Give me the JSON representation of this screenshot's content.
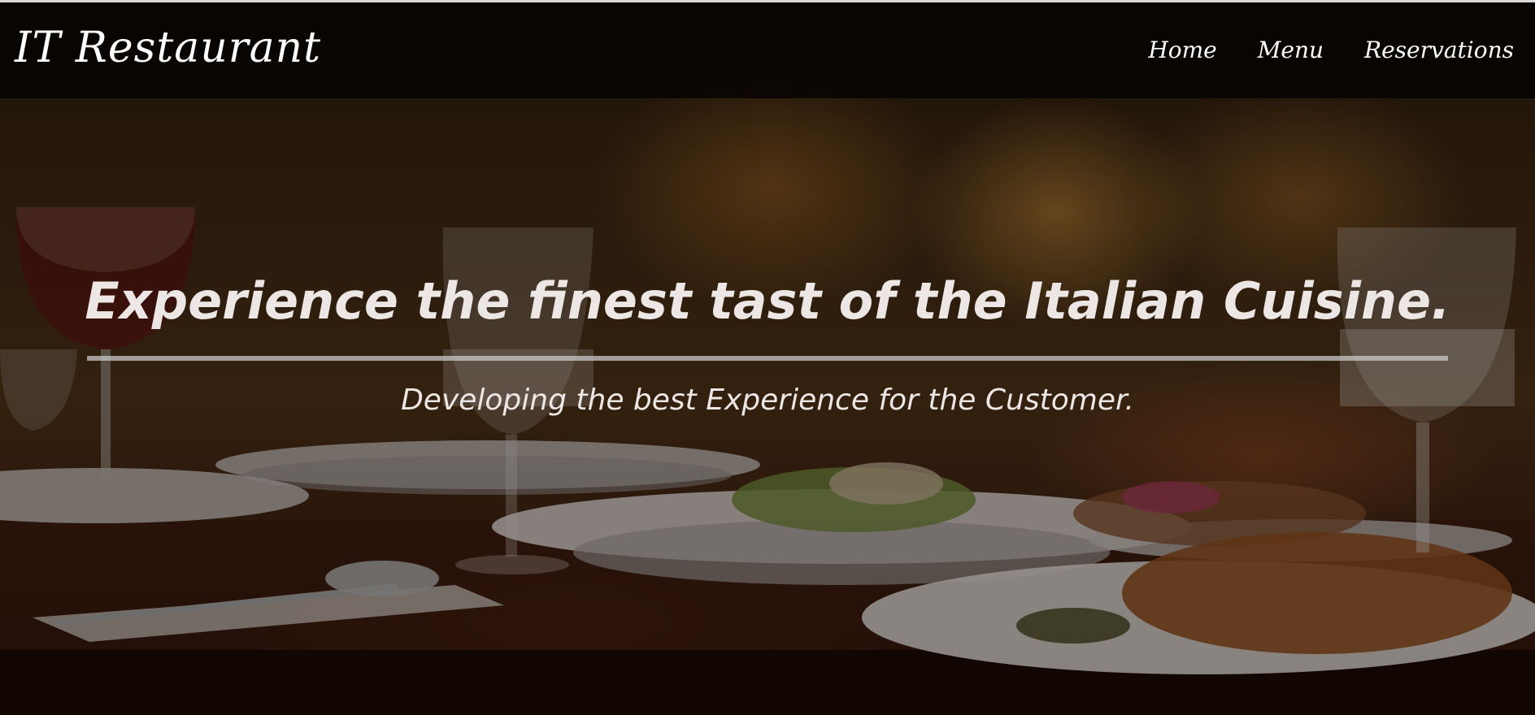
{
  "navbar": {
    "brand": "IT Restaurant",
    "links": [
      {
        "label": "Home"
      },
      {
        "label": "Menu"
      },
      {
        "label": "Reservations"
      }
    ]
  },
  "hero": {
    "title": "Experience the finest tast of the Italian Cuisine.",
    "subtitle": "Developing the best Experience for the Customer.",
    "background_image": "restaurant-table-photo"
  },
  "colors": {
    "navbar_bg": "#000000",
    "text": "#ece7e4",
    "divider": "#c8c8c8"
  }
}
